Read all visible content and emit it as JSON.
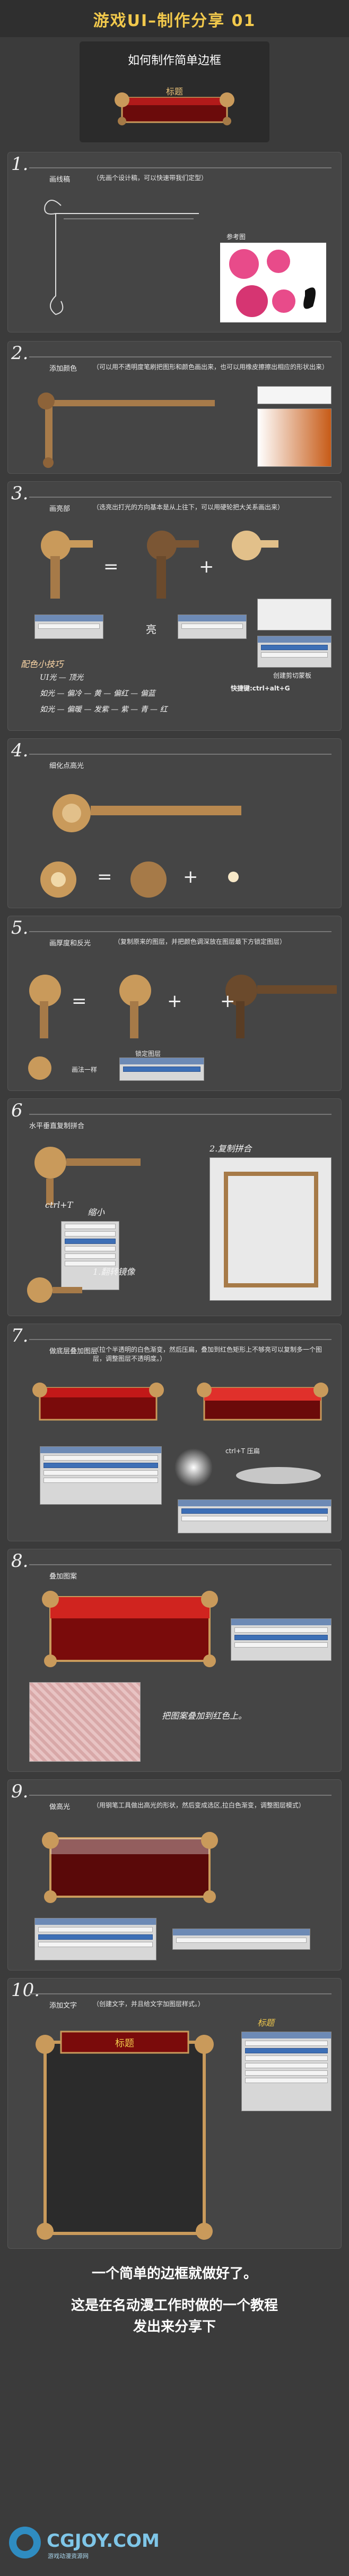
{
  "title": "游戏UI–制作分享 01",
  "hero": {
    "subtitle": "如何制作简单边框",
    "frame_label": "标题"
  },
  "colors": {
    "title": "#f2c94c",
    "gold": "#c99a5b",
    "red": "#8b0f10",
    "bg": "#3b3b3b"
  },
  "sections": [
    {
      "num": "1.",
      "head": "画线稿",
      "desc": "（先画个设计稿，可以快速带我们定型）",
      "ref_label": "参考图"
    },
    {
      "num": "2.",
      "head": "添加颜色",
      "desc": "（可以用不透明度笔刷把图形和颜色画出来，也可以用橡皮擦擦出相应的形状出来）"
    },
    {
      "num": "3.",
      "head": "画亮部",
      "desc": "（选亮出打光的方向基本是从上往下，可以用硬轮把大关系画出来）",
      "equals": "=",
      "plus": "+",
      "light_label": "亮",
      "clip_label": "创建剪切蒙板",
      "shortcut_label": "快捷键:ctrl+alt+G",
      "tips_title": "配色小技巧",
      "tips": [
        "UI光 — 顶光",
        "如光 — 偏冷 — 黄 — 偏红 — 偏蓝",
        "如光 — 偏暖 — 发紫 — 紫 — 青 — 红"
      ]
    },
    {
      "num": "4.",
      "head": "细化点高光"
    },
    {
      "num": "5.",
      "head": "画厚度和反光",
      "desc": "（复制原来的图层，并把颜色调深放在图层最下方锁定图层）",
      "same_label": "画法一样",
      "lock_label": "锁定图层"
    },
    {
      "num": "6",
      "head": "水平垂直复制拼合",
      "copy_label": "2.复制拼合",
      "shortcut": "ctrl+T",
      "shrink_label": "缩小",
      "flip_label": "1.翻转镜像"
    },
    {
      "num": "7.",
      "head": "做底层叠加图层",
      "desc": "（拉个半透明的白色渐变，然后压扁，叠加到红色矩形上不够亮可以复制多一个图层，调整图层不透明度。）",
      "transform_label": "ctrl+T 压扁"
    },
    {
      "num": "8.",
      "head": "叠加图案",
      "note": "把图案叠加到红色上。"
    },
    {
      "num": "9.",
      "head": "做高光",
      "desc": "（用钢笔工具做出高光的形状，然后变成选区,拉白色渐变，调整图层模式）"
    },
    {
      "num": "10.",
      "head": "添加文字",
      "desc": "（创建文字，并且给文字加图层样式。）",
      "sample_text": "标题"
    }
  ],
  "footer": {
    "line1": "一个简单的边框就做好了。",
    "line2": "这是在名动漫工作时做的一个教程",
    "line3": "发出来分享下"
  },
  "logo": {
    "text": "CGJOY.COM",
    "url": "游戏动漫资源网"
  }
}
